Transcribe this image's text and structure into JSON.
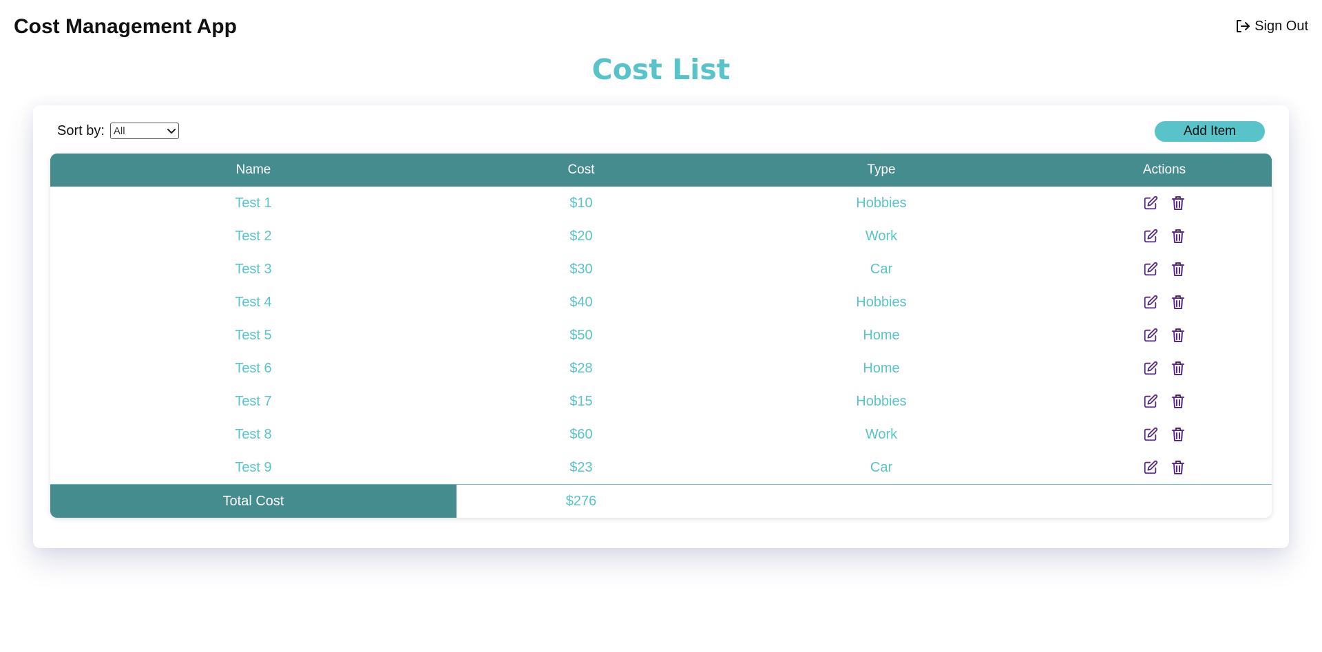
{
  "app": {
    "title": "Cost Management App",
    "sign_out_label": "Sign Out"
  },
  "page": {
    "title": "Cost List"
  },
  "toolbar": {
    "sort_label": "Sort by:",
    "sort_selected": "All",
    "add_label": "Add Item"
  },
  "table": {
    "headers": [
      "Name",
      "Cost",
      "Type",
      "Actions"
    ],
    "rows": [
      {
        "name": "Test 1",
        "cost": "$10",
        "type": "Hobbies"
      },
      {
        "name": "Test 2",
        "cost": "$20",
        "type": "Work"
      },
      {
        "name": "Test 3",
        "cost": "$30",
        "type": "Car"
      },
      {
        "name": "Test 4",
        "cost": "$40",
        "type": "Hobbies"
      },
      {
        "name": "Test 5",
        "cost": "$50",
        "type": "Home"
      },
      {
        "name": "Test 6",
        "cost": "$28",
        "type": "Home"
      },
      {
        "name": "Test 7",
        "cost": "$15",
        "type": "Hobbies"
      },
      {
        "name": "Test 8",
        "cost": "$60",
        "type": "Work"
      },
      {
        "name": "Test 9",
        "cost": "$23",
        "type": "Car"
      }
    ],
    "total_label": "Total Cost",
    "total_value": "$276"
  },
  "icons": {
    "sign_out": "sign-out-icon",
    "edit": "edit-icon",
    "delete": "trash-icon",
    "dropdown": "chevron-down-icon"
  },
  "colors": {
    "accent": "#58c3c8",
    "table_header": "#458c8e",
    "action_icon": "#5b2a86"
  }
}
